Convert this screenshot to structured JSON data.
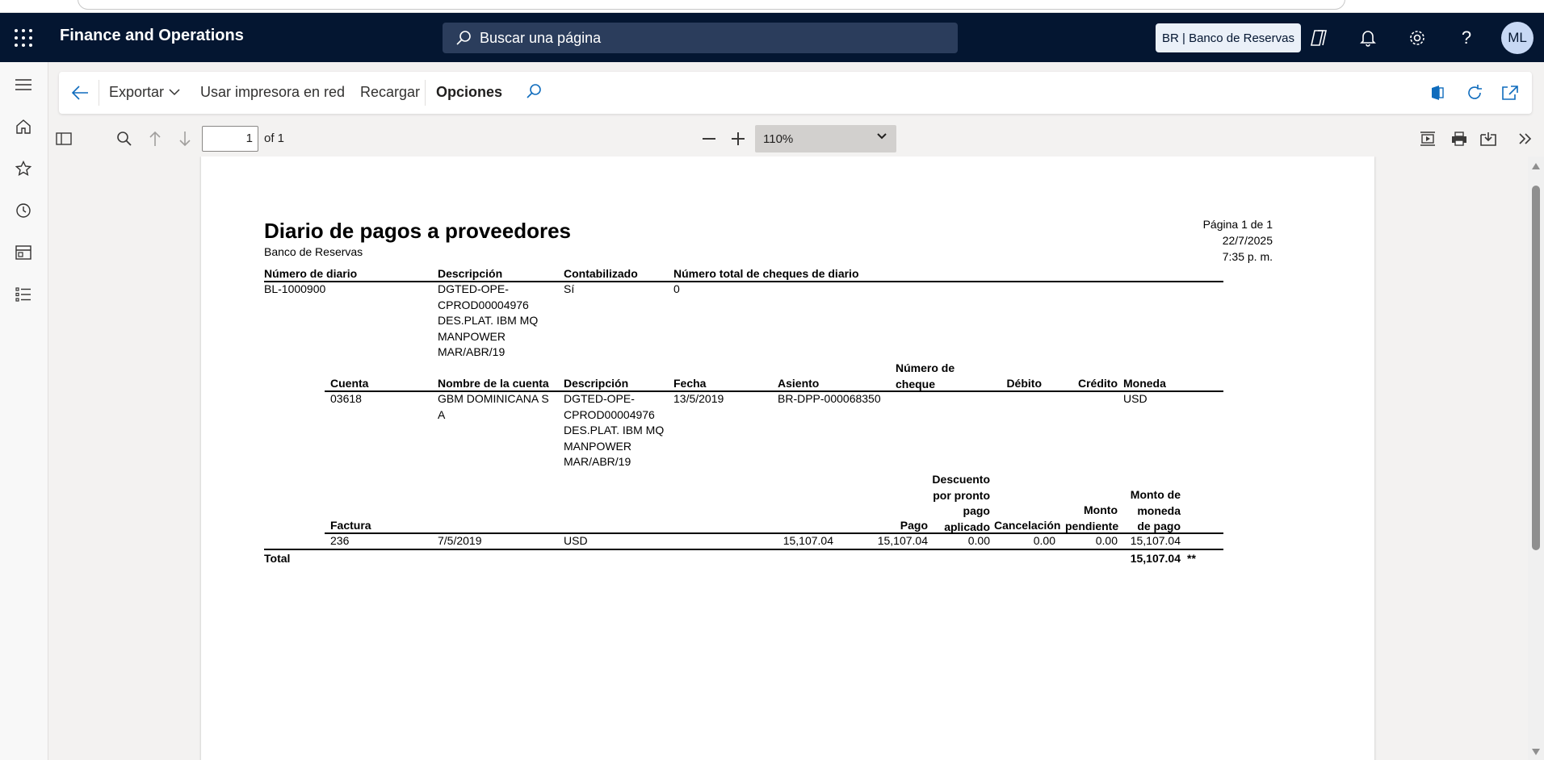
{
  "app": {
    "title": "Finance and Operations",
    "search_placeholder": "Buscar una página",
    "company": "BR | Banco de Reservas",
    "avatar_initials": "ML"
  },
  "action_pane": {
    "export_label": "Exportar",
    "network_printer_label": "Usar impresora en red",
    "reload_label": "Recargar",
    "options_label": "Opciones"
  },
  "pdf_toolbar": {
    "page_number": "1",
    "page_of": "of 1",
    "zoom": "110%"
  },
  "report": {
    "title": "Diario de pagos a proveedores",
    "company": "Banco de Reservas",
    "page_info": "Página 1 de 1",
    "date": "22/7/2025",
    "time": "7:35 p. m.",
    "header_columns": {
      "journal_number": "Número de diario",
      "description": "Descripción",
      "posted": "Contabilizado",
      "total_checks": "Número total de cheques de diario"
    },
    "header_values": {
      "journal_number": "BL-1000900",
      "description": "DGTED-OPE-CPROD00004976 DES.PLAT. IBM MQ MANPOWER MAR/ABR/19",
      "posted": "Sí",
      "total_checks": "0"
    },
    "line_columns": {
      "account": "Cuenta",
      "account_name": "Nombre de la cuenta",
      "description": "Descripción",
      "date": "Fecha",
      "voucher": "Asiento",
      "check_number": "Número de cheque",
      "debit": "Débito",
      "credit": "Crédito",
      "currency": "Moneda"
    },
    "line_values": {
      "account": "03618",
      "account_name": "GBM DOMINICANA S A",
      "description": "DGTED-OPE-CPROD00004976 DES.PLAT. IBM MQ MANPOWER MAR/ABR/19",
      "date": "13/5/2019",
      "voucher": "BR-DPP-000068350",
      "check_number": "",
      "debit": "",
      "credit": "",
      "currency": "USD"
    },
    "invoice_columns": {
      "invoice": "Factura",
      "payment": "Pago",
      "cash_discount": "Descuento por pronto pago aplicado",
      "cancellation": "Cancelación",
      "remaining": "Monto pendiente",
      "payment_currency_amount": "Monto de moneda de pago"
    },
    "invoice_values": {
      "invoice": "236",
      "date": "7/5/2019",
      "currency": "USD",
      "amount": "15,107.04",
      "payment": "15,107.04",
      "cash_discount": "0.00",
      "cancellation": "0.00",
      "remaining": "0.00",
      "payment_currency_amount": "15,107.04"
    },
    "total": {
      "label": "Total",
      "value": "15,107.04",
      "marker": "**"
    }
  }
}
